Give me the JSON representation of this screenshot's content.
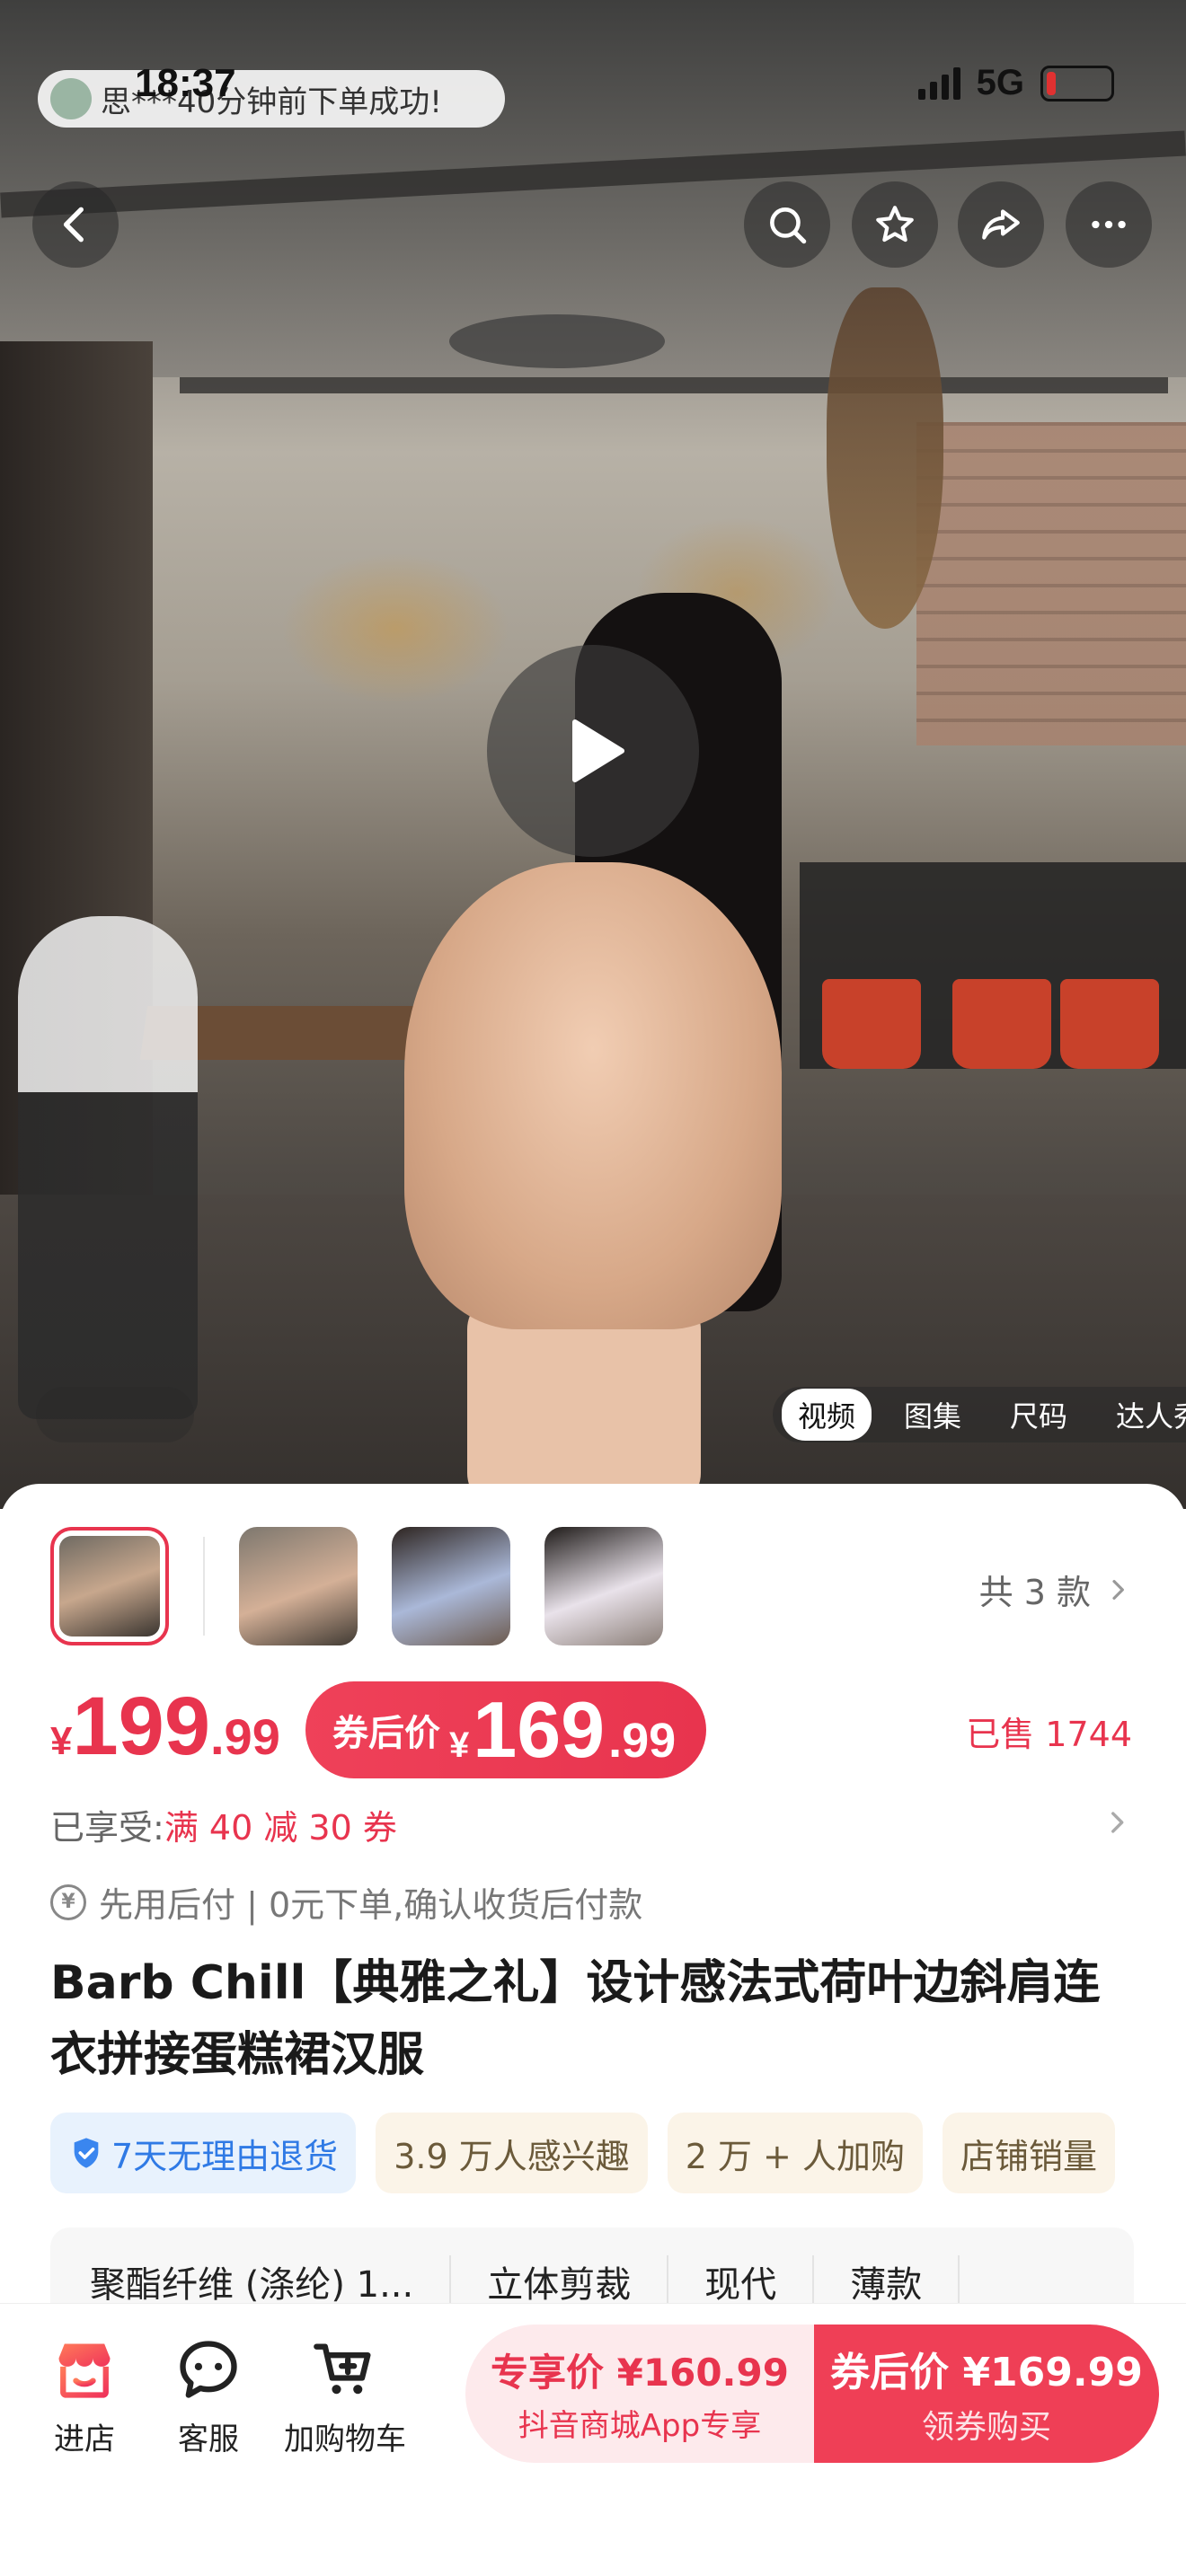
{
  "status_bar": {
    "time": "18:37",
    "network": "5G"
  },
  "notification": {
    "text": "思***40分钟前下单成功!"
  },
  "media": {
    "tabs": [
      {
        "label": "视频",
        "active": true
      },
      {
        "label": "图集",
        "active": false
      },
      {
        "label": "尺码",
        "active": false
      },
      {
        "label": "达人秀",
        "active": false
      }
    ]
  },
  "variants": {
    "count_label": "共 3 款"
  },
  "price": {
    "original": {
      "currency": "¥",
      "integer": "199",
      "decimal": ".99"
    },
    "coupon": {
      "label": "券后价",
      "currency": "¥",
      "integer": "169",
      "decimal": ".99"
    },
    "sold": "已售 1744"
  },
  "promo": {
    "prefix": "已享受:",
    "value": "满 40 减 30 券"
  },
  "pay_later": {
    "icon": "yen-icon",
    "text": "先用后付 | 0元下单,确认收货后付款"
  },
  "product_title": "Barb Chill【典雅之礼】设计感法式荷叶边斜肩连衣拼接蛋糕裙汉服",
  "tags": [
    {
      "label": "7天无理由退货",
      "style": "blue",
      "icon": "shield-check-icon"
    },
    {
      "label": "3.9 万人感兴趣",
      "style": "cream"
    },
    {
      "label": "2 万 + 人加购",
      "style": "cream"
    },
    {
      "label": "店铺销量",
      "style": "cream"
    }
  ],
  "attributes": [
    "聚酯纤维 (涤纶) 1...",
    "立体剪裁",
    "现代",
    "薄款"
  ],
  "bottom_bar": {
    "store": "进店",
    "service": "客服",
    "cart": "加购物车",
    "exclusive": {
      "line1": "专享价 ¥160.99",
      "line2": "抖音商城App专享"
    },
    "buy": {
      "line1": "券后价 ¥169.99",
      "line2": "领券购买"
    }
  },
  "colors": {
    "accent": "#e8344e",
    "tag_blue": "#2f7ae5"
  }
}
